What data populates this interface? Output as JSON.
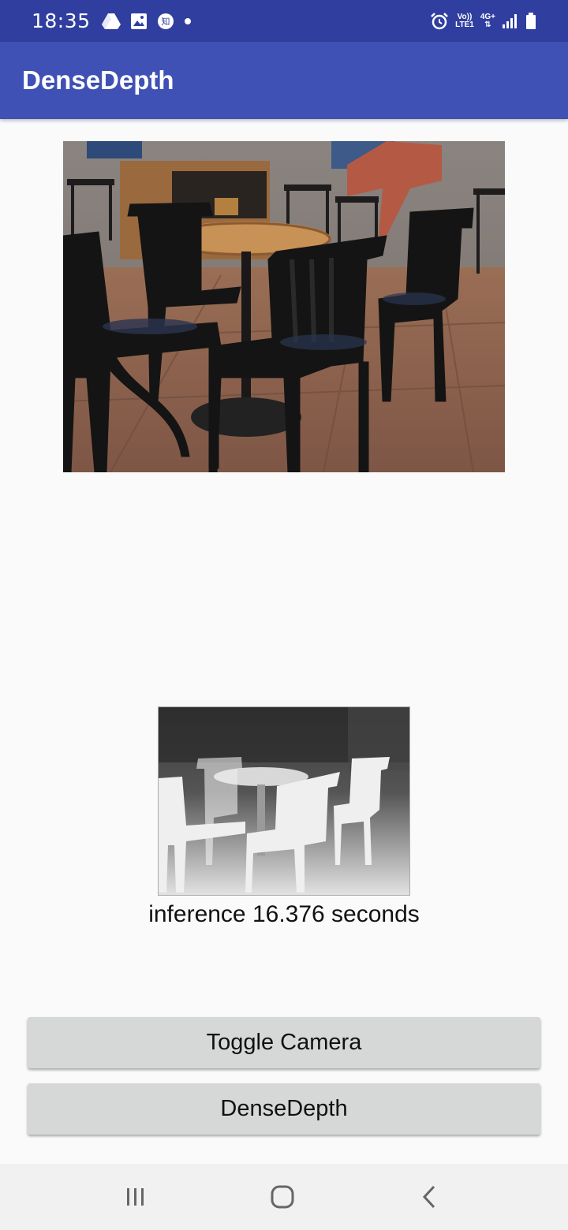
{
  "status_bar": {
    "time": "18:35",
    "left_icons": [
      "drive-icon",
      "image-icon",
      "zhihu-icon",
      "dot-icon"
    ],
    "volte_label_top": "Vo))",
    "volte_label_bottom": "LTE1",
    "network_label": "4G+",
    "right_icons": [
      "alarm-icon",
      "volte-icon",
      "network-4g-icon",
      "signal-icon",
      "battery-icon"
    ]
  },
  "app_bar": {
    "title": "DenseDepth"
  },
  "main": {
    "inference_text": "inference 16.376 seconds"
  },
  "buttons": {
    "toggle_camera": "Toggle Camera",
    "dense_depth": "DenseDepth"
  },
  "nav_bar": {
    "icons": [
      "recents-icon",
      "home-icon",
      "back-icon"
    ]
  },
  "colors": {
    "status_bar": "#303f9f",
    "app_bar": "#3f51b5",
    "background": "#fafafa",
    "button": "#d6d7d7",
    "nav_bar": "#f1f1f1"
  }
}
